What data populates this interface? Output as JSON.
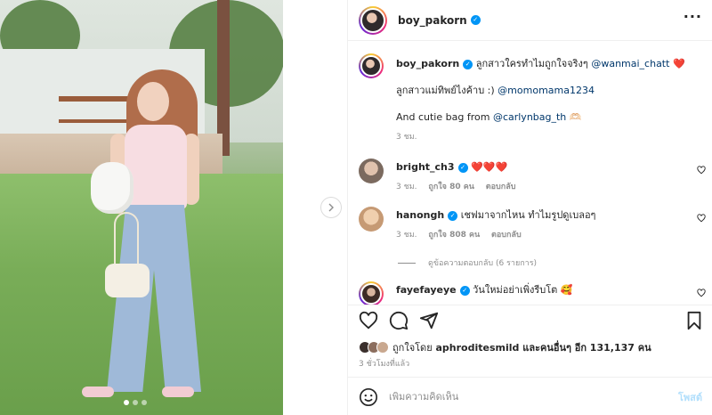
{
  "post": {
    "author": "boy_pakorn",
    "photo_dots": 3,
    "active_dot": 1
  },
  "caption": {
    "username": "boy_pakorn",
    "line1_text": "ลูกสาวใครทำไมถูกใจจริงๆ",
    "line1_mention": "@wanmai_chatt",
    "line1_emoji": "❤️",
    "line2_text": "ลูกสาวแม่ทิพย์ไงค้าบ :)",
    "line2_mention": "@momomama1234",
    "line3_text": "And cutie bag from",
    "line3_mention": "@carlynbag_th",
    "line3_emoji": "🫶🏻",
    "time": "3 ชม."
  },
  "comments": [
    {
      "username": "bright_ch3",
      "text": "❤️❤️❤️",
      "time": "3 ชม.",
      "likes": "ถูกใจ 80 คน",
      "reply": "ตอบกลับ"
    },
    {
      "username": "hanongh",
      "text": "เชฟมาจากไหน ทำไมรูปดูเบลอๆ",
      "time": "3 ชม.",
      "likes": "ถูกใจ 808 คน",
      "reply": "ตอบกลับ",
      "view_replies": "ดูข้อความตอบกลับ (6 รายการ)"
    },
    {
      "username": "fayefayeye",
      "text": "วันใหม่อย่าเพิ่งรีบโต 🥰"
    }
  ],
  "likes_summary": {
    "prefix": "ถูกใจโดย",
    "user": "aphroditesmild",
    "suffix": "และคนอื่นๆ อีก 131,137 คน"
  },
  "posted_ago": "3 ชั่วโมงที่แล้ว",
  "comment_box": {
    "placeholder": "เพิ่มความคิดเห็น",
    "post_label": "โพสต์"
  },
  "icons": {
    "more": "more-options-icon",
    "next": "chevron-right-icon",
    "like": "heart-icon",
    "comment": "comment-icon",
    "share": "send-icon",
    "save": "bookmark-icon",
    "emoji": "emoji-icon",
    "verified": "verified-badge-icon"
  },
  "colors": {
    "verified": "#0095f6",
    "mention": "#00376b",
    "muted": "#8e8e8e",
    "post_button_disabled": "#b2dffc"
  }
}
